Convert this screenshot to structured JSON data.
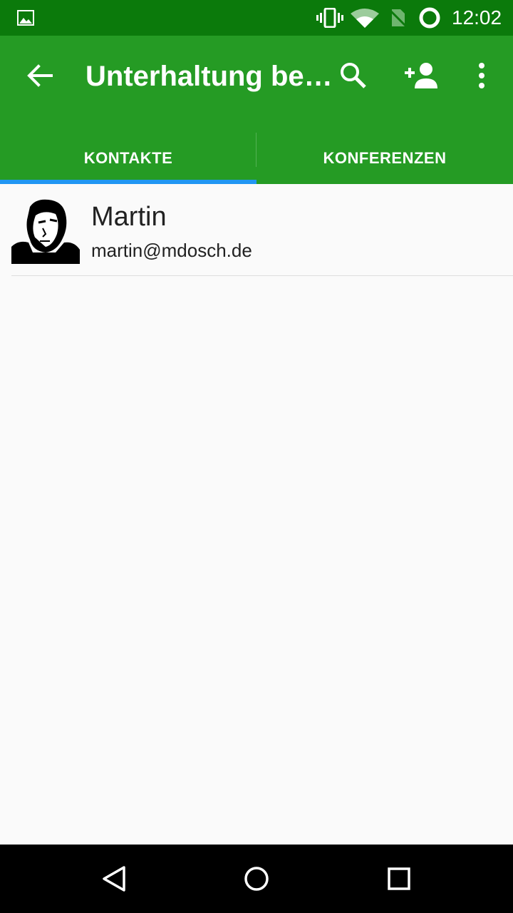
{
  "status_bar": {
    "time": "12:02",
    "icons": [
      "image-icon",
      "vibrate-icon",
      "wifi-icon",
      "no-sim-icon",
      "battery-icon"
    ]
  },
  "app_bar": {
    "title": "Unterhaltung be…",
    "actions": [
      "back-arrow-icon",
      "search-icon",
      "add-contact-icon",
      "more-vert-icon"
    ],
    "background": "#259b24"
  },
  "tabs": [
    {
      "label": "KONTAKTE",
      "selected": true
    },
    {
      "label": "KONFERENZEN",
      "selected": false
    }
  ],
  "tab_indicator_color": "#2196f3",
  "contacts": [
    {
      "name": "Martin",
      "jid": "martin@mdosch.de",
      "avatar": "avatar-photo"
    }
  ],
  "nav_bar": {
    "buttons": [
      "nav-back-icon",
      "nav-home-icon",
      "nav-recents-icon"
    ]
  }
}
